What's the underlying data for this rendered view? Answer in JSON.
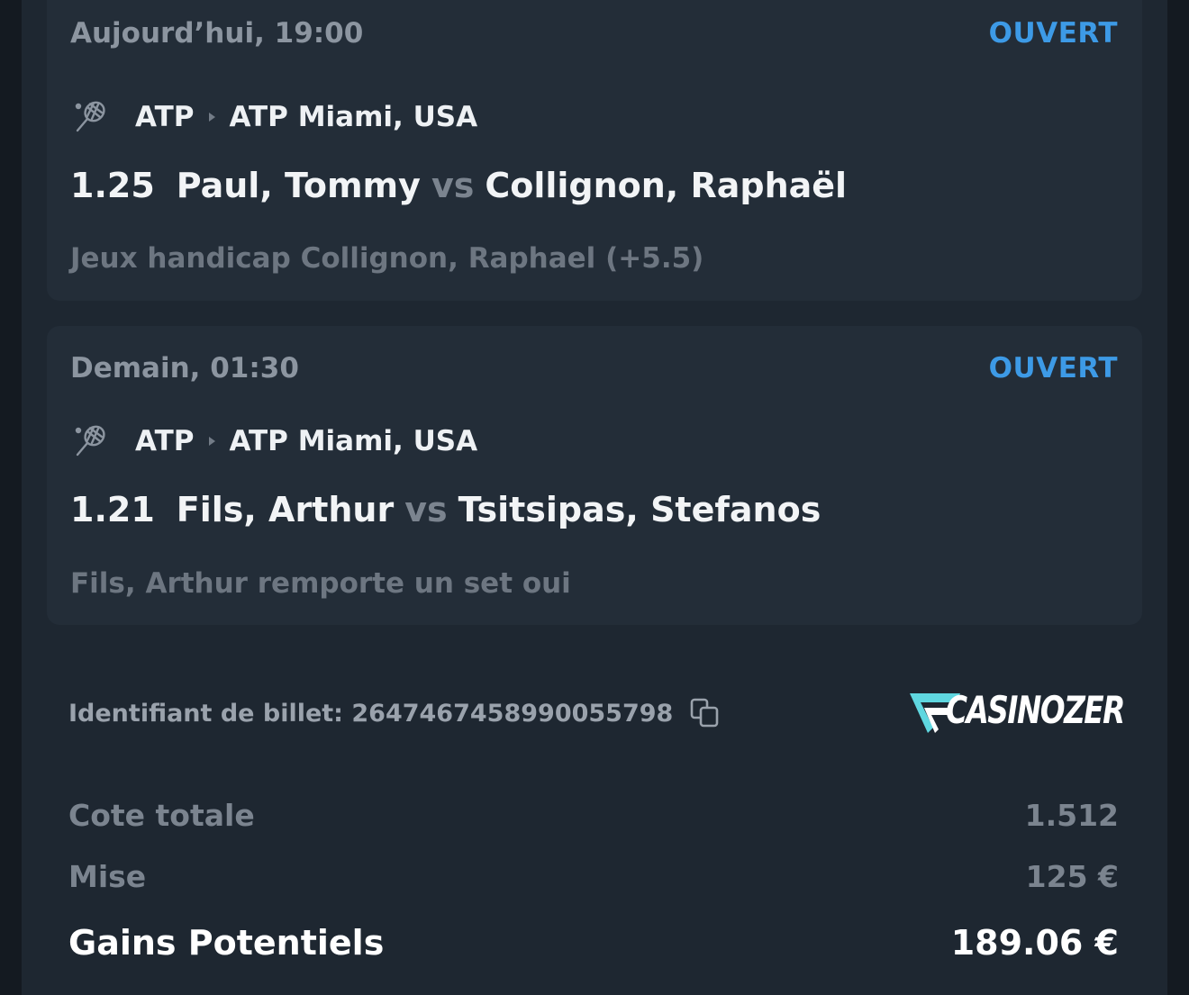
{
  "bets": [
    {
      "when": "Aujourd’hui, 19:00",
      "status": "OUVERT",
      "sport_icon": "tennis-racket-icon",
      "league": "ATP",
      "tournament": "ATP Miami, USA",
      "odd": "1.25",
      "home": "Paul, Tommy",
      "vs": "vs",
      "away": "Collignon, Raphaël",
      "market": "Jeux handicap Collignon, Raphael (+5.5)"
    },
    {
      "when": "Demain, 01:30",
      "status": "OUVERT",
      "sport_icon": "tennis-racket-icon",
      "league": "ATP",
      "tournament": "ATP Miami, USA",
      "odd": "1.21",
      "home": "Fils, Arthur",
      "vs": "vs",
      "away": "Tsitsipas, Stefanos",
      "market": "Fils, Arthur remporte un set oui"
    }
  ],
  "ticket": {
    "label": "Identifiant de billet: 2647467458990055798",
    "copy_icon": "copy-icon"
  },
  "brand": {
    "logo_text": "CASINOZER"
  },
  "summary": {
    "total_odds_label": "Cote totale",
    "total_odds_value": "1.512",
    "stake_label": "Mise",
    "stake_value": "125 €",
    "potential_label": "Gains Potentiels",
    "potential_value": "189.06 €"
  },
  "colors": {
    "background": "#141a21",
    "panel": "#1e2731",
    "card": "#232d38",
    "status_open": "#3d9ae6",
    "logo_accent": "#5fd7e0"
  }
}
